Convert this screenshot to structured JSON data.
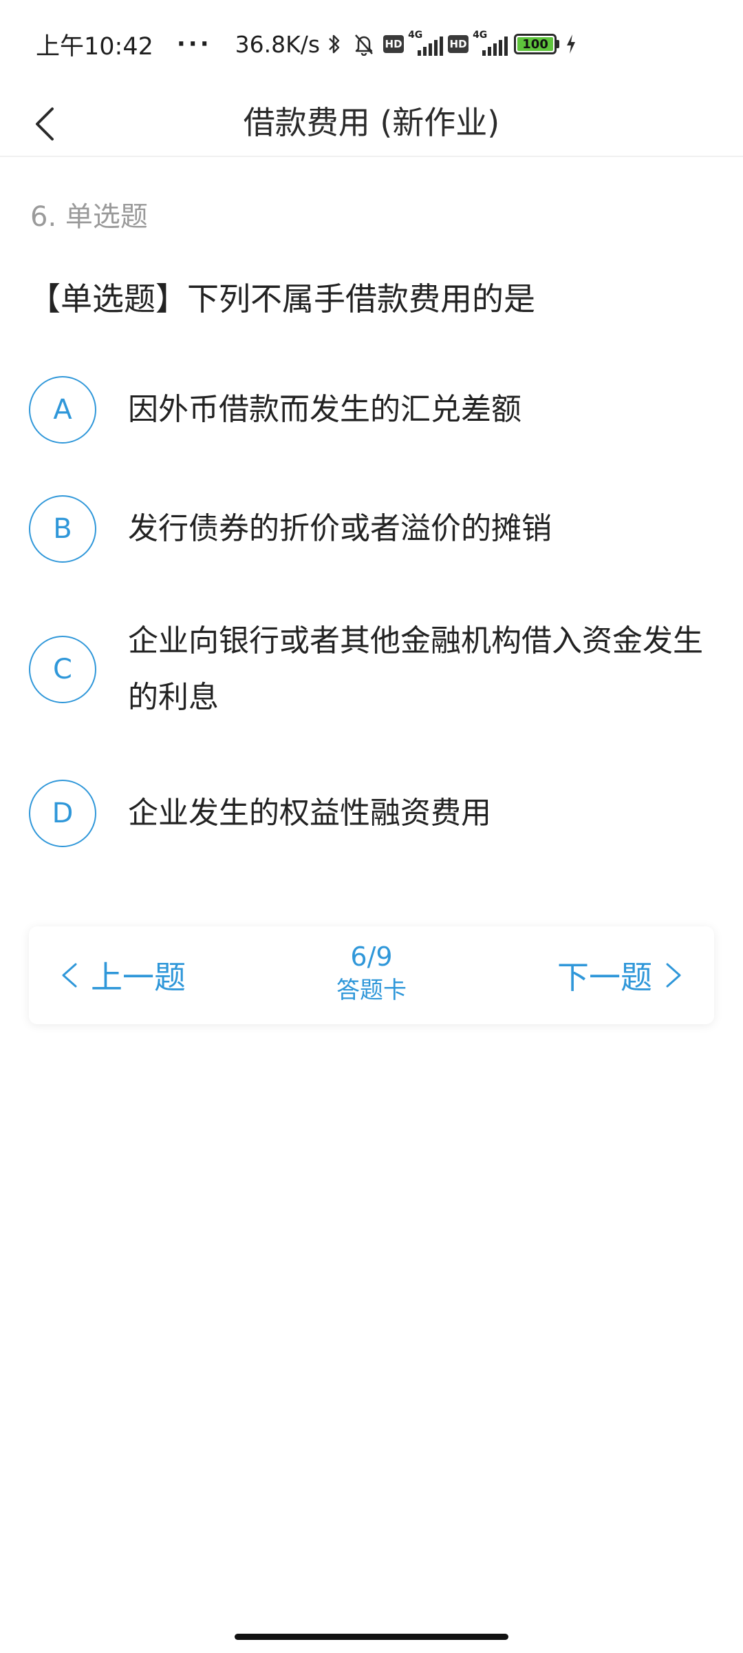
{
  "status_bar": {
    "time": "上午10:42",
    "more": "···",
    "speed": "36.8K/s",
    "icons": [
      "bluetooth-icon",
      "mute-bell-icon",
      "hd-icon",
      "signal-4g-icon",
      "hd-icon",
      "signal-4g-icon",
      "battery-icon",
      "charging-icon"
    ],
    "hd_label": "HD",
    "network_label": "4G",
    "battery_level": "100"
  },
  "header": {
    "title": "借款费用 (新作业)",
    "back_icon": "chevron-left-icon"
  },
  "question": {
    "number_label": "6. 单选题",
    "stem": "【单选题】下列不属手借款费用的是",
    "options": [
      {
        "letter": "A",
        "text": "因外币借款而发生的汇兑差额"
      },
      {
        "letter": "B",
        "text": "发行债券的折价或者溢价的摊销"
      },
      {
        "letter": "C",
        "text": "企业向银行或者其他金融机构借入资金发生的利息"
      },
      {
        "letter": "D",
        "text": "企业发生的权益性融资费用"
      }
    ]
  },
  "footer_nav": {
    "prev_label": "上一题",
    "next_label": "下一题",
    "progress": "6/9",
    "answer_card_label": "答题卡"
  },
  "colors": {
    "accent": "#2f97d9",
    "muted_text": "#9a9a9a",
    "primary_text": "#222222",
    "battery_fill": "#5ec43c"
  }
}
